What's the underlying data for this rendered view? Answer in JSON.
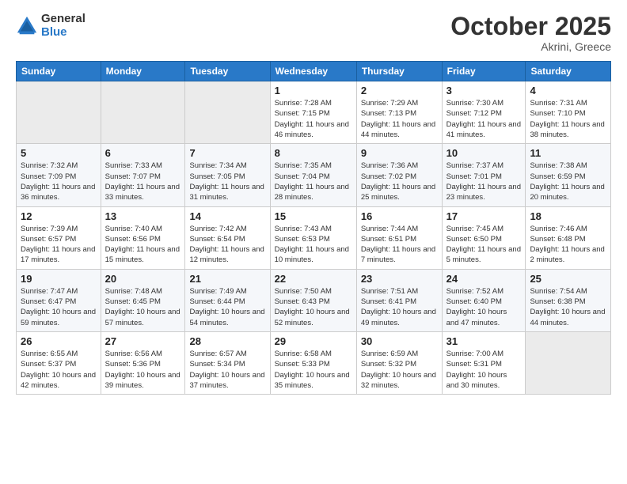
{
  "logo": {
    "line1": "General",
    "line2": "Blue"
  },
  "title": "October 2025",
  "subtitle": "Akrini, Greece",
  "days_header": [
    "Sunday",
    "Monday",
    "Tuesday",
    "Wednesday",
    "Thursday",
    "Friday",
    "Saturday"
  ],
  "weeks": [
    [
      {
        "num": "",
        "sunrise": "",
        "sunset": "",
        "daylight": ""
      },
      {
        "num": "",
        "sunrise": "",
        "sunset": "",
        "daylight": ""
      },
      {
        "num": "",
        "sunrise": "",
        "sunset": "",
        "daylight": ""
      },
      {
        "num": "1",
        "sunrise": "Sunrise: 7:28 AM",
        "sunset": "Sunset: 7:15 PM",
        "daylight": "Daylight: 11 hours and 46 minutes."
      },
      {
        "num": "2",
        "sunrise": "Sunrise: 7:29 AM",
        "sunset": "Sunset: 7:13 PM",
        "daylight": "Daylight: 11 hours and 44 minutes."
      },
      {
        "num": "3",
        "sunrise": "Sunrise: 7:30 AM",
        "sunset": "Sunset: 7:12 PM",
        "daylight": "Daylight: 11 hours and 41 minutes."
      },
      {
        "num": "4",
        "sunrise": "Sunrise: 7:31 AM",
        "sunset": "Sunset: 7:10 PM",
        "daylight": "Daylight: 11 hours and 38 minutes."
      }
    ],
    [
      {
        "num": "5",
        "sunrise": "Sunrise: 7:32 AM",
        "sunset": "Sunset: 7:09 PM",
        "daylight": "Daylight: 11 hours and 36 minutes."
      },
      {
        "num": "6",
        "sunrise": "Sunrise: 7:33 AM",
        "sunset": "Sunset: 7:07 PM",
        "daylight": "Daylight: 11 hours and 33 minutes."
      },
      {
        "num": "7",
        "sunrise": "Sunrise: 7:34 AM",
        "sunset": "Sunset: 7:05 PM",
        "daylight": "Daylight: 11 hours and 31 minutes."
      },
      {
        "num": "8",
        "sunrise": "Sunrise: 7:35 AM",
        "sunset": "Sunset: 7:04 PM",
        "daylight": "Daylight: 11 hours and 28 minutes."
      },
      {
        "num": "9",
        "sunrise": "Sunrise: 7:36 AM",
        "sunset": "Sunset: 7:02 PM",
        "daylight": "Daylight: 11 hours and 25 minutes."
      },
      {
        "num": "10",
        "sunrise": "Sunrise: 7:37 AM",
        "sunset": "Sunset: 7:01 PM",
        "daylight": "Daylight: 11 hours and 23 minutes."
      },
      {
        "num": "11",
        "sunrise": "Sunrise: 7:38 AM",
        "sunset": "Sunset: 6:59 PM",
        "daylight": "Daylight: 11 hours and 20 minutes."
      }
    ],
    [
      {
        "num": "12",
        "sunrise": "Sunrise: 7:39 AM",
        "sunset": "Sunset: 6:57 PM",
        "daylight": "Daylight: 11 hours and 17 minutes."
      },
      {
        "num": "13",
        "sunrise": "Sunrise: 7:40 AM",
        "sunset": "Sunset: 6:56 PM",
        "daylight": "Daylight: 11 hours and 15 minutes."
      },
      {
        "num": "14",
        "sunrise": "Sunrise: 7:42 AM",
        "sunset": "Sunset: 6:54 PM",
        "daylight": "Daylight: 11 hours and 12 minutes."
      },
      {
        "num": "15",
        "sunrise": "Sunrise: 7:43 AM",
        "sunset": "Sunset: 6:53 PM",
        "daylight": "Daylight: 11 hours and 10 minutes."
      },
      {
        "num": "16",
        "sunrise": "Sunrise: 7:44 AM",
        "sunset": "Sunset: 6:51 PM",
        "daylight": "Daylight: 11 hours and 7 minutes."
      },
      {
        "num": "17",
        "sunrise": "Sunrise: 7:45 AM",
        "sunset": "Sunset: 6:50 PM",
        "daylight": "Daylight: 11 hours and 5 minutes."
      },
      {
        "num": "18",
        "sunrise": "Sunrise: 7:46 AM",
        "sunset": "Sunset: 6:48 PM",
        "daylight": "Daylight: 11 hours and 2 minutes."
      }
    ],
    [
      {
        "num": "19",
        "sunrise": "Sunrise: 7:47 AM",
        "sunset": "Sunset: 6:47 PM",
        "daylight": "Daylight: 10 hours and 59 minutes."
      },
      {
        "num": "20",
        "sunrise": "Sunrise: 7:48 AM",
        "sunset": "Sunset: 6:45 PM",
        "daylight": "Daylight: 10 hours and 57 minutes."
      },
      {
        "num": "21",
        "sunrise": "Sunrise: 7:49 AM",
        "sunset": "Sunset: 6:44 PM",
        "daylight": "Daylight: 10 hours and 54 minutes."
      },
      {
        "num": "22",
        "sunrise": "Sunrise: 7:50 AM",
        "sunset": "Sunset: 6:43 PM",
        "daylight": "Daylight: 10 hours and 52 minutes."
      },
      {
        "num": "23",
        "sunrise": "Sunrise: 7:51 AM",
        "sunset": "Sunset: 6:41 PM",
        "daylight": "Daylight: 10 hours and 49 minutes."
      },
      {
        "num": "24",
        "sunrise": "Sunrise: 7:52 AM",
        "sunset": "Sunset: 6:40 PM",
        "daylight": "Daylight: 10 hours and 47 minutes."
      },
      {
        "num": "25",
        "sunrise": "Sunrise: 7:54 AM",
        "sunset": "Sunset: 6:38 PM",
        "daylight": "Daylight: 10 hours and 44 minutes."
      }
    ],
    [
      {
        "num": "26",
        "sunrise": "Sunrise: 6:55 AM",
        "sunset": "Sunset: 5:37 PM",
        "daylight": "Daylight: 10 hours and 42 minutes."
      },
      {
        "num": "27",
        "sunrise": "Sunrise: 6:56 AM",
        "sunset": "Sunset: 5:36 PM",
        "daylight": "Daylight: 10 hours and 39 minutes."
      },
      {
        "num": "28",
        "sunrise": "Sunrise: 6:57 AM",
        "sunset": "Sunset: 5:34 PM",
        "daylight": "Daylight: 10 hours and 37 minutes."
      },
      {
        "num": "29",
        "sunrise": "Sunrise: 6:58 AM",
        "sunset": "Sunset: 5:33 PM",
        "daylight": "Daylight: 10 hours and 35 minutes."
      },
      {
        "num": "30",
        "sunrise": "Sunrise: 6:59 AM",
        "sunset": "Sunset: 5:32 PM",
        "daylight": "Daylight: 10 hours and 32 minutes."
      },
      {
        "num": "31",
        "sunrise": "Sunrise: 7:00 AM",
        "sunset": "Sunset: 5:31 PM",
        "daylight": "Daylight: 10 hours and 30 minutes."
      },
      {
        "num": "",
        "sunrise": "",
        "sunset": "",
        "daylight": ""
      }
    ]
  ]
}
